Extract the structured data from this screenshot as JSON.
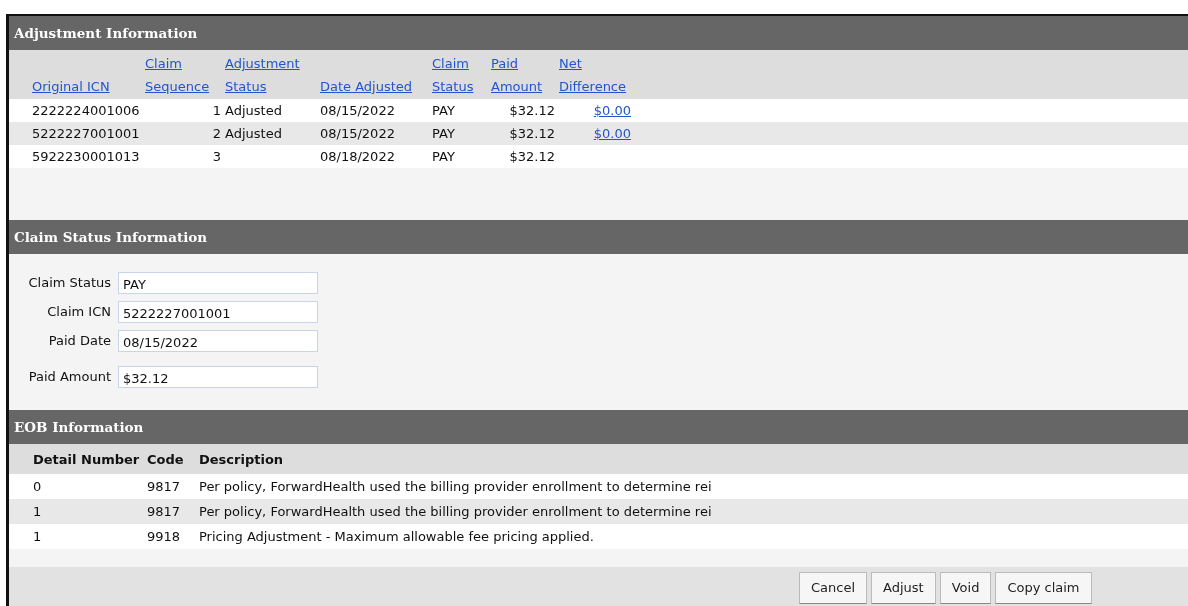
{
  "adjustment_information": {
    "title": "Adjustment Information",
    "columns": [
      "Original ICN",
      "Claim Sequence",
      "Adjustment Status",
      "Date Adjusted",
      "Claim Status",
      "Paid Amount",
      "Net Difference"
    ],
    "rows": [
      {
        "cells": [
          "2222224001006",
          "1",
          "Adjusted",
          "08/15/2022",
          "PAY",
          "$32.12",
          "$0.00"
        ]
      },
      {
        "cells": [
          "5222227001001",
          "2",
          "Adjusted",
          "08/15/2022",
          "PAY",
          "$32.12",
          "$0.00"
        ]
      },
      {
        "cells": [
          "5922230001013",
          "3",
          "",
          "08/18/2022",
          "PAY",
          "$32.12",
          ""
        ]
      }
    ]
  },
  "claim_status_information": {
    "title": "Claim Status Information",
    "fields": [
      {
        "label": "Claim Status",
        "value": "PAY"
      },
      {
        "label": "Claim ICN",
        "value": "5222227001001"
      },
      {
        "label": "Paid Date",
        "value": "08/15/2022"
      },
      {
        "label": "Paid Amount",
        "value": "$32.12"
      }
    ]
  },
  "eob_information": {
    "title": "EOB Information",
    "columns": [
      "Detail Number",
      "Code",
      "Description"
    ],
    "rows": [
      {
        "cells": [
          "0",
          "9817",
          "Per policy, ForwardHealth used the billing provider enrollment to determine rei"
        ]
      },
      {
        "cells": [
          "1",
          "9817",
          "Per policy, ForwardHealth used the billing provider enrollment to determine rei"
        ]
      },
      {
        "cells": [
          "1",
          "9918",
          "Pricing Adjustment - Maximum allowable fee pricing applied."
        ]
      }
    ]
  },
  "buttons": [
    "Cancel",
    "Adjust",
    "Void",
    "Copy claim"
  ]
}
